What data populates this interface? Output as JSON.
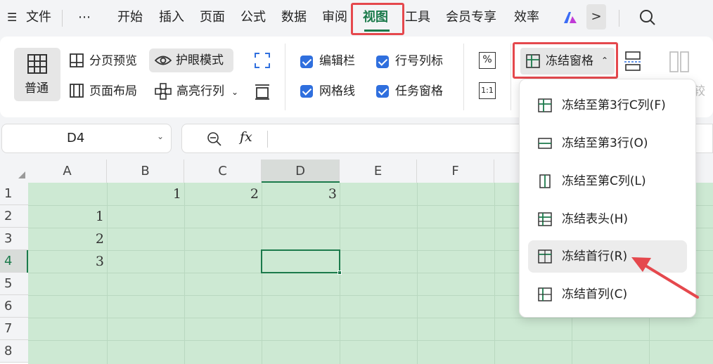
{
  "menubar": {
    "hamburger_icon": "☰",
    "items": [
      "文件",
      "⋯",
      "开始",
      "插入",
      "页面",
      "公式",
      "数据",
      "审阅",
      "视图",
      "工具",
      "会员专享",
      "效率"
    ],
    "more_label": ">"
  },
  "ribbon": {
    "normal_label": "普通",
    "page_break_label": "分页预览",
    "page_layout_label": "页面布局",
    "eye_mode_label": "护眼模式",
    "highlight_label": "高亮行列",
    "formula_bar_label": "编辑栏",
    "gridlines_label": "网格线",
    "headings_label": "行号列标",
    "taskpane_label": "任务窗格",
    "zoom_label": "%",
    "zoom100_label": "1:1",
    "freeze_label": "冻结窗格",
    "compare_partial": "较"
  },
  "formula_bar": {
    "cell_ref": "D4",
    "fx_label": "fx"
  },
  "sheet": {
    "columns": [
      "A",
      "B",
      "C",
      "D",
      "E",
      "F"
    ],
    "rows": [
      "1",
      "2",
      "3",
      "4",
      "5",
      "6",
      "7",
      "8"
    ],
    "row1_values": [
      "1",
      "2",
      "3"
    ],
    "colA_values": [
      "1",
      "2",
      "3"
    ]
  },
  "freeze_menu": {
    "items": [
      {
        "label": "冻结至第3行C列(F)",
        "icon": "freeze-rows-cols-icon"
      },
      {
        "label": "冻结至第3行(O)",
        "icon": "freeze-rows-icon"
      },
      {
        "label": "冻结至第C列(L)",
        "icon": "freeze-cols-icon"
      },
      {
        "label": "冻结表头(H)",
        "icon": "freeze-header-icon"
      },
      {
        "label": "冻结首行(R)",
        "icon": "freeze-first-row-icon"
      },
      {
        "label": "冻结首列(C)",
        "icon": "freeze-first-col-icon"
      }
    ]
  },
  "colors": {
    "accent_green": "#1b7a4b",
    "highlight_red": "#e5484d",
    "checkbox_blue": "#2f6fde",
    "sheet_fill": "#cde9d3"
  }
}
